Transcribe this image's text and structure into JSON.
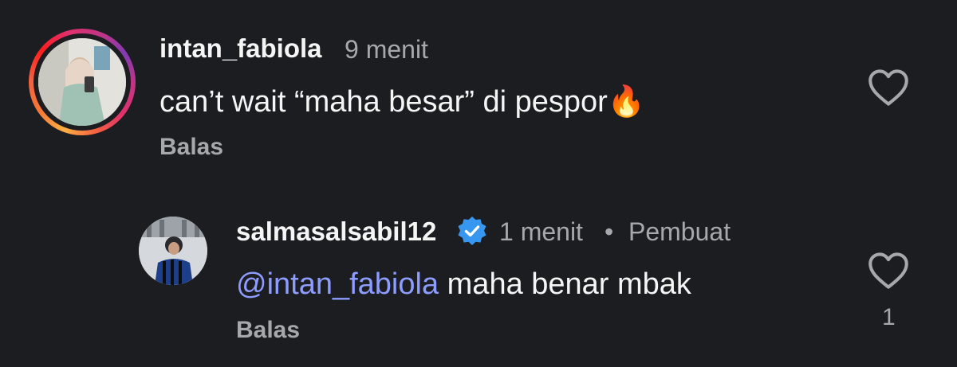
{
  "comments": [
    {
      "username": "intan_fabiola",
      "time": "9 menit",
      "text": "can’t wait “maha besar” di pespor",
      "emoji": "🔥",
      "reply_label": "Balas",
      "like_icon": "heart-outline-icon"
    },
    {
      "username": "salmasalsabil12",
      "verified": true,
      "time": "1 menit",
      "separator": "•",
      "author_badge": "Pembuat",
      "mention": "@intan_fabiola",
      "text": " maha benar mbak",
      "reply_label": "Balas",
      "like_icon": "heart-outline-icon",
      "like_count": "1"
    }
  ],
  "colors": {
    "background": "#1c1d21",
    "primary_text": "#f5f5f5",
    "secondary_text": "#a7a8ad",
    "mention": "#8d9cff",
    "verified_badge": "#3797f0"
  }
}
